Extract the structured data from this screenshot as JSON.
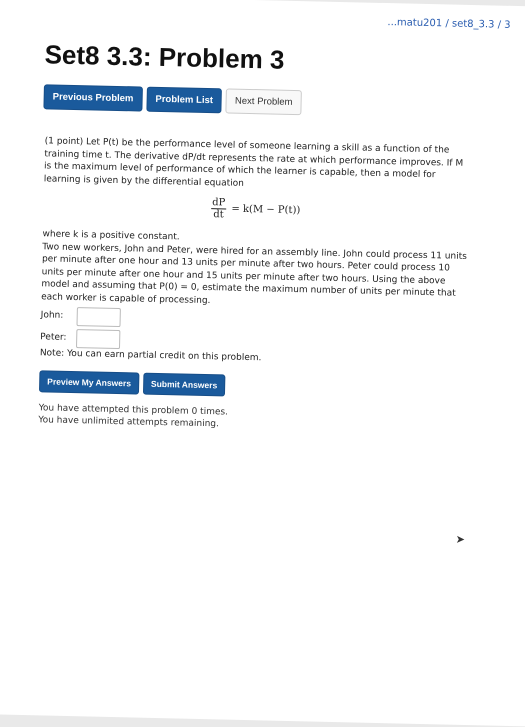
{
  "breadcrumb": "...matu201 / set8_3.3 / 3",
  "title": "Set8 3.3: Problem 3",
  "nav": {
    "previous": "Previous Problem",
    "list": "Problem List",
    "next": "Next Problem"
  },
  "problem": {
    "intro": "(1 point) Let P(t) be the performance level of someone learning a skill as a function of the training time t. The derivative dP/dt represents the rate at which performance improves. If M is the maximum level of performance of which the learner is capable, then a model for learning is given by the differential equation",
    "eq_num": "dP",
    "eq_den": "dt",
    "eq_rhs": "= k(M − P(t))",
    "where": "where k is a positive constant.",
    "body": "Two new workers, John and Peter, were hired for an assembly line. John could process 11 units per minute after one hour and 13 units per minute after two hours. Peter could process 10 units per minute after one hour and 15 units per minute after two hours. Using the above model and assuming that P(0) = 0, estimate the maximum number of units per minute that each worker is capable of processing.",
    "answers": [
      {
        "label": "John:",
        "value": ""
      },
      {
        "label": "Peter:",
        "value": ""
      }
    ],
    "note": "Note: You can earn partial credit on this problem.",
    "preview_btn": "Preview My Answers",
    "submit_btn": "Submit Answers",
    "status1": "You have attempted this problem 0 times.",
    "status2": "You have unlimited attempts remaining."
  },
  "colors": {
    "primary": "#1a5a9c",
    "link": "#2a5db0"
  }
}
